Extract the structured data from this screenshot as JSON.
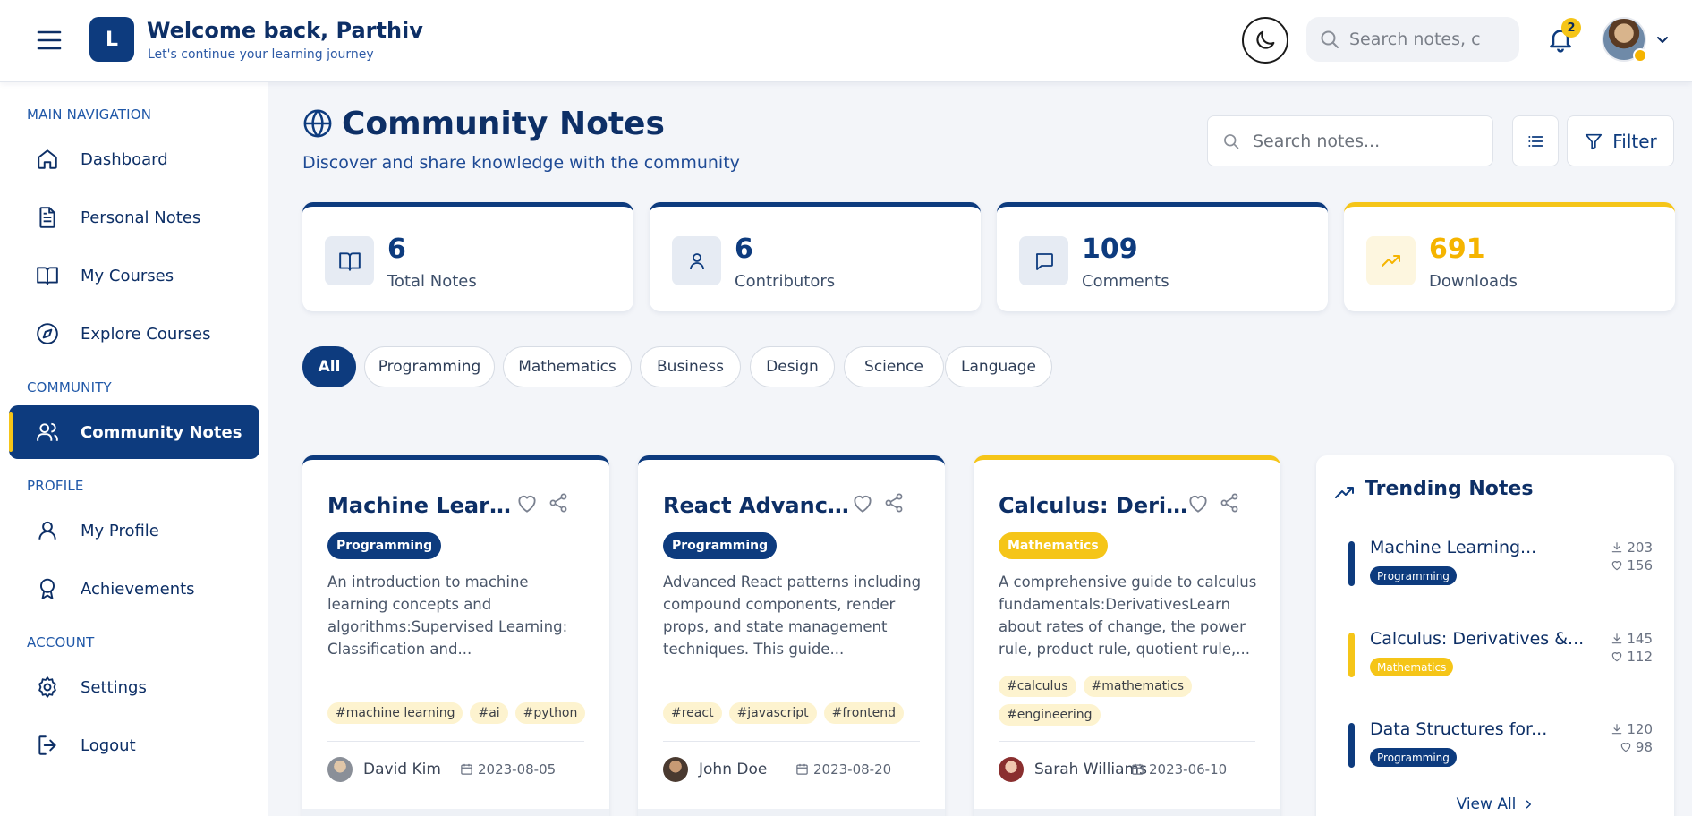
{
  "header": {
    "logo_letter": "L",
    "welcome_title": "Welcome back, Parthiv",
    "welcome_subtitle": "Let's continue your learning journey",
    "search_placeholder": "Search notes, c",
    "notification_count": "2"
  },
  "sidebar": {
    "sections": [
      "MAIN NAVIGATION",
      "COMMUNITY",
      "PROFILE",
      "ACCOUNT"
    ],
    "items": [
      {
        "label": "Dashboard",
        "icon": "home-icon"
      },
      {
        "label": "Personal Notes",
        "icon": "document-icon"
      },
      {
        "label": "My Courses",
        "icon": "book-open-icon"
      },
      {
        "label": "Explore Courses",
        "icon": "compass-icon"
      },
      {
        "label": "Community Notes",
        "icon": "users-icon",
        "active": true
      },
      {
        "label": "My Profile",
        "icon": "user-icon"
      },
      {
        "label": "Achievements",
        "icon": "award-icon"
      },
      {
        "label": "Settings",
        "icon": "gear-icon"
      },
      {
        "label": "Logout",
        "icon": "logout-icon"
      }
    ]
  },
  "main": {
    "title": "Community Notes",
    "subtitle": "Discover and share knowledge with the community",
    "search_placeholder": "Search notes...",
    "filter_label": "Filter",
    "stats": [
      {
        "value": "6",
        "label": "Total Notes",
        "icon": "book-icon"
      },
      {
        "value": "6",
        "label": "Contributors",
        "icon": "user-icon"
      },
      {
        "value": "109",
        "label": "Comments",
        "icon": "comment-icon"
      },
      {
        "value": "691",
        "label": "Downloads",
        "icon": "trending-up-icon"
      }
    ],
    "categories": [
      "All",
      "Programming",
      "Mathematics",
      "Business",
      "Design",
      "Science",
      "Language"
    ],
    "notes": [
      {
        "title": "Machine Learnin...",
        "category": "Programming",
        "description": "An introduction to machine learning concepts and algorithms:Supervised Learning: Classification and...",
        "tags": [
          "#machine learning",
          "#ai",
          "#python"
        ],
        "author": "David Kim",
        "date": "2023-08-05"
      },
      {
        "title": "React Advanced ...",
        "category": "Programming",
        "description": "Advanced React patterns including compound components, render props, and state management techniques. This guide...",
        "tags": [
          "#react",
          "#javascript",
          "#frontend"
        ],
        "author": "John Doe",
        "date": "2023-08-20"
      },
      {
        "title": "Calculus: Derivat...",
        "category": "Mathematics",
        "description": "A comprehensive guide to calculus fundamentals:DerivativesLearn about rates of change, the power rule, product rule, quotient rule,...",
        "tags": [
          "#calculus",
          "#mathematics",
          "#engineering"
        ],
        "author": "Sarah Williams",
        "date": "2023-06-10"
      }
    ]
  },
  "trending": {
    "title": "Trending Notes",
    "items": [
      {
        "name": "Machine Learning...",
        "category": "Programming",
        "downloads": "203",
        "likes": "156"
      },
      {
        "name": "Calculus: Derivatives &...",
        "category": "Mathematics",
        "downloads": "145",
        "likes": "112"
      },
      {
        "name": "Data Structures for...",
        "category": "Programming",
        "downloads": "120",
        "likes": "98"
      }
    ],
    "view_all": "View All"
  },
  "colors": {
    "primary": "#0d3b7e",
    "accent": "#f5c518",
    "background": "#f3f5f9"
  }
}
